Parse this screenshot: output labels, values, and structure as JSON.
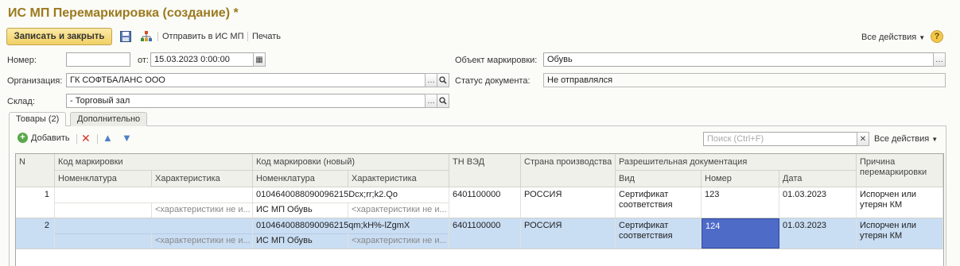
{
  "window": {
    "title": "ИС МП Перемаркировка (создание) *"
  },
  "toolbar": {
    "save_close": "Записать и закрыть",
    "send": "Отправить в ИС МП",
    "print": "Печать",
    "all_actions": "Все действия",
    "help": "?"
  },
  "header": {
    "number_label": "Номер:",
    "number_value": "",
    "date_label": "от:",
    "date_value": "15.03.2023  0:00:00",
    "org_label": "Организация:",
    "org_value": "ГК СОФТБАЛАНС ООО",
    "warehouse_label": "Склад:",
    "warehouse_value": "- Торговый зал",
    "object_label": "Объект маркировки:",
    "object_value": "Обувь",
    "status_label": "Статус документа:",
    "status_value": "Не отправлялся"
  },
  "tabs": [
    {
      "label": "Товары (2)"
    },
    {
      "label": "Дополнительно"
    }
  ],
  "grid_toolbar": {
    "add": "Добавить",
    "search_placeholder": "Поиск (Ctrl+F)",
    "all_actions": "Все действия"
  },
  "columns": {
    "n": "N",
    "code": "Код маркировки",
    "code_nom": "Номенклатура",
    "code_char": "Характеристика",
    "new_code": "Код маркировки (новый)",
    "new_nom": "Номенклатура",
    "new_char": "Характеристика",
    "tnved": "ТН ВЭД",
    "country": "Страна производства",
    "docs": "Разрешительная документация",
    "doc_kind": "Вид",
    "doc_number": "Номер",
    "doc_date": "Дата",
    "reason": "Причина перемаркировки"
  },
  "rows": [
    {
      "n": "1",
      "char_old": "<характеристики не и...",
      "new_code": "0104640088090096215Dcx;rr;k2.Qo",
      "new_nom": "ИС МП Обувь",
      "new_char": "<характеристики не и...",
      "tnved": "6401100000",
      "country": "РОССИЯ",
      "doc_kind": "Сертификат соответствия",
      "doc_number": "123",
      "doc_date": "01.03.2023",
      "reason": "Испорчен или утерян КМ"
    },
    {
      "n": "2",
      "char_old": "<характеристики не и...",
      "new_code": "0104640088090096215qm;kH%-lZgmX",
      "new_nom": "ИС МП Обувь",
      "new_char": "<характеристики не и...",
      "tnved": "6401100000",
      "country": "РОССИЯ",
      "doc_kind": "Сертификат соответствия",
      "doc_number": "124",
      "doc_date": "01.03.2023",
      "reason": "Испорчен или утерян КМ"
    }
  ]
}
